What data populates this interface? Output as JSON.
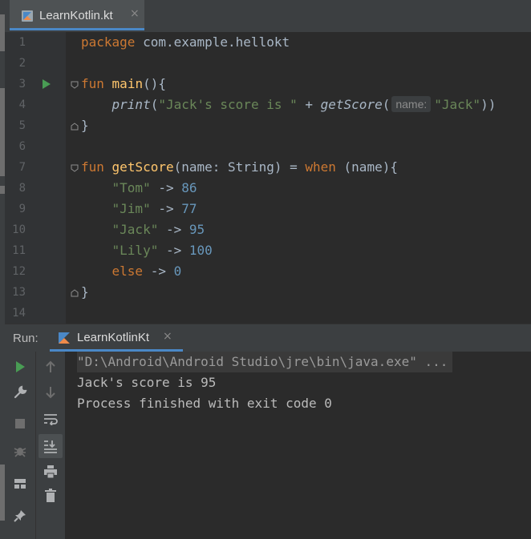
{
  "editor_tab": {
    "label": "LearnKotlin.kt",
    "close": "×"
  },
  "code": {
    "line_numbers": [
      "1",
      "2",
      "3",
      "4",
      "5",
      "6",
      "7",
      "8",
      "9",
      "10",
      "11",
      "12",
      "13",
      "14"
    ],
    "l1_kw": "package",
    "l1_rest": " com.example.hellokt",
    "l3_kw": "fun",
    "l3_fn": "main",
    "l3_rest": "(){",
    "l4_call": "print",
    "l4_open": "(",
    "l4_str": "\"Jack's score is \"",
    "l4_plus": " + ",
    "l4_call2": "getScore",
    "l4_open2": "(",
    "l4_hint": "name:",
    "l4_arg": "\"Jack\"",
    "l4_close": "))",
    "l5_text": "}",
    "l7_kw": "fun",
    "l7_fn": "getScore",
    "l7_mid": "(name: String) = ",
    "l7_kw2": "when",
    "l7_rest": " (name){",
    "l8_str": "\"Tom\"",
    "l8_arrow": " -> ",
    "l8_num": "86",
    "l9_str": "\"Jim\"",
    "l9_arrow": " -> ",
    "l9_num": "77",
    "l10_str": "\"Jack\"",
    "l10_arrow": " -> ",
    "l10_num": "95",
    "l11_str": "\"Lily\"",
    "l11_arrow": " -> ",
    "l11_num": "100",
    "l12_kw": "else",
    "l12_arrow": " -> ",
    "l12_num": "0",
    "l13_text": "}"
  },
  "run_panel": {
    "label": "Run:",
    "tab_label": "LearnKotlinKt",
    "tab_close": "×",
    "console": [
      "\"D:\\Android\\Android Studio\\jre\\bin\\java.exe\" ...",
      "Jack's score is 95",
      "Process finished with exit code 0"
    ]
  },
  "colors": {
    "keyword": "#cc7832",
    "function": "#ffc66d",
    "string": "#6a8759",
    "number": "#6897bb",
    "run_green": "#499c54",
    "accent": "#4a88c7"
  },
  "icons": [
    "kotlin-file-icon",
    "run-gutter-icon",
    "fold-icon",
    "rerun-icon",
    "wrench-icon",
    "stop-icon",
    "debug-bug-icon",
    "layout-icon",
    "pin-icon",
    "up-arrow-icon",
    "down-arrow-icon",
    "soft-wrap-icon",
    "scroll-to-end-icon",
    "print-icon",
    "trash-icon"
  ]
}
